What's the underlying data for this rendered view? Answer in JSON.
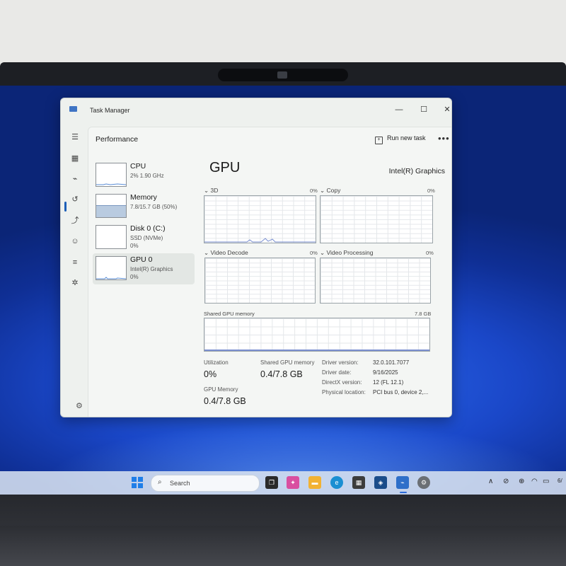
{
  "window": {
    "title": "Task Manager",
    "controls": {
      "minimize": "—",
      "maximize": "☐",
      "close": "✕"
    }
  },
  "header": {
    "title": "Performance",
    "run_new_task": "Run new task",
    "more": "•••"
  },
  "devices": [
    {
      "name": "CPU",
      "line1": "2%  1.90 GHz",
      "line2": ""
    },
    {
      "name": "Memory",
      "line1": "7.8/15.7 GB (50%)",
      "line2": ""
    },
    {
      "name": "Disk 0 (C:)",
      "line1": "SSD (NVMe)",
      "line2": "0%"
    },
    {
      "name": "GPU 0",
      "line1": "Intel(R) Graphics",
      "line2": "0%"
    }
  ],
  "detail": {
    "title": "GPU",
    "model": "Intel(R) Graphics",
    "graphs": [
      {
        "label": "3D",
        "percent": "0%"
      },
      {
        "label": "Copy",
        "percent": "0%"
      },
      {
        "label": "Video Decode",
        "percent": "0%"
      },
      {
        "label": "Video Processing",
        "percent": "0%"
      }
    ],
    "shared_memory_label": "Shared GPU memory",
    "shared_memory_max": "7.8 GB",
    "utilization_label": "Utilization",
    "utilization_value": "0%",
    "shared_gpu_memory_label": "Shared GPU memory",
    "shared_gpu_memory_value": "0.4/7.8 GB",
    "gpu_memory_label": "GPU Memory",
    "gpu_memory_value": "0.4/7.8 GB",
    "properties": [
      {
        "label": "Driver version:",
        "value": "32.0.101.7077"
      },
      {
        "label": "Driver date:",
        "value": "9/16/2025"
      },
      {
        "label": "DirectX version:",
        "value": "12 (FL 12.1)"
      },
      {
        "label": "Physical location:",
        "value": "PCI bus 0, device 2,..."
      }
    ]
  },
  "taskbar": {
    "search_placeholder": "Search",
    "date_fragment": "6/"
  },
  "colors": {
    "accent": "#1d5fb8",
    "memory_fill": "#b9cbe0",
    "graph_line": "#7a8fd0"
  }
}
